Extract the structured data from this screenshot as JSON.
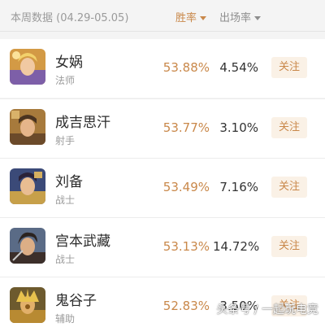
{
  "header": {
    "period": "本周数据 (04.29-05.05)",
    "winrate_label": "胜率",
    "pickrate_label": "出场率"
  },
  "heroes": [
    {
      "name": "女娲",
      "role": "法师",
      "win_rate": "53.88%",
      "pick_rate": "4.54%",
      "follow": "关注"
    },
    {
      "name": "成吉思汗",
      "role": "射手",
      "win_rate": "53.77%",
      "pick_rate": "3.10%",
      "follow": "关注"
    },
    {
      "name": "刘备",
      "role": "战士",
      "win_rate": "53.49%",
      "pick_rate": "7.16%",
      "follow": "关注"
    },
    {
      "name": "宫本武藏",
      "role": "战士",
      "win_rate": "53.13%",
      "pick_rate": "14.72%",
      "follow": "关注"
    },
    {
      "name": "鬼谷子",
      "role": "辅助",
      "win_rate": "52.83%",
      "pick_rate": "3.50%",
      "follow": "关注"
    }
  ],
  "watermark": "头条号 / 一起玩电竞",
  "colors": {
    "accent": "#c9884a",
    "follow_bg": "#faf1e6",
    "background": "#f4f4f4"
  }
}
